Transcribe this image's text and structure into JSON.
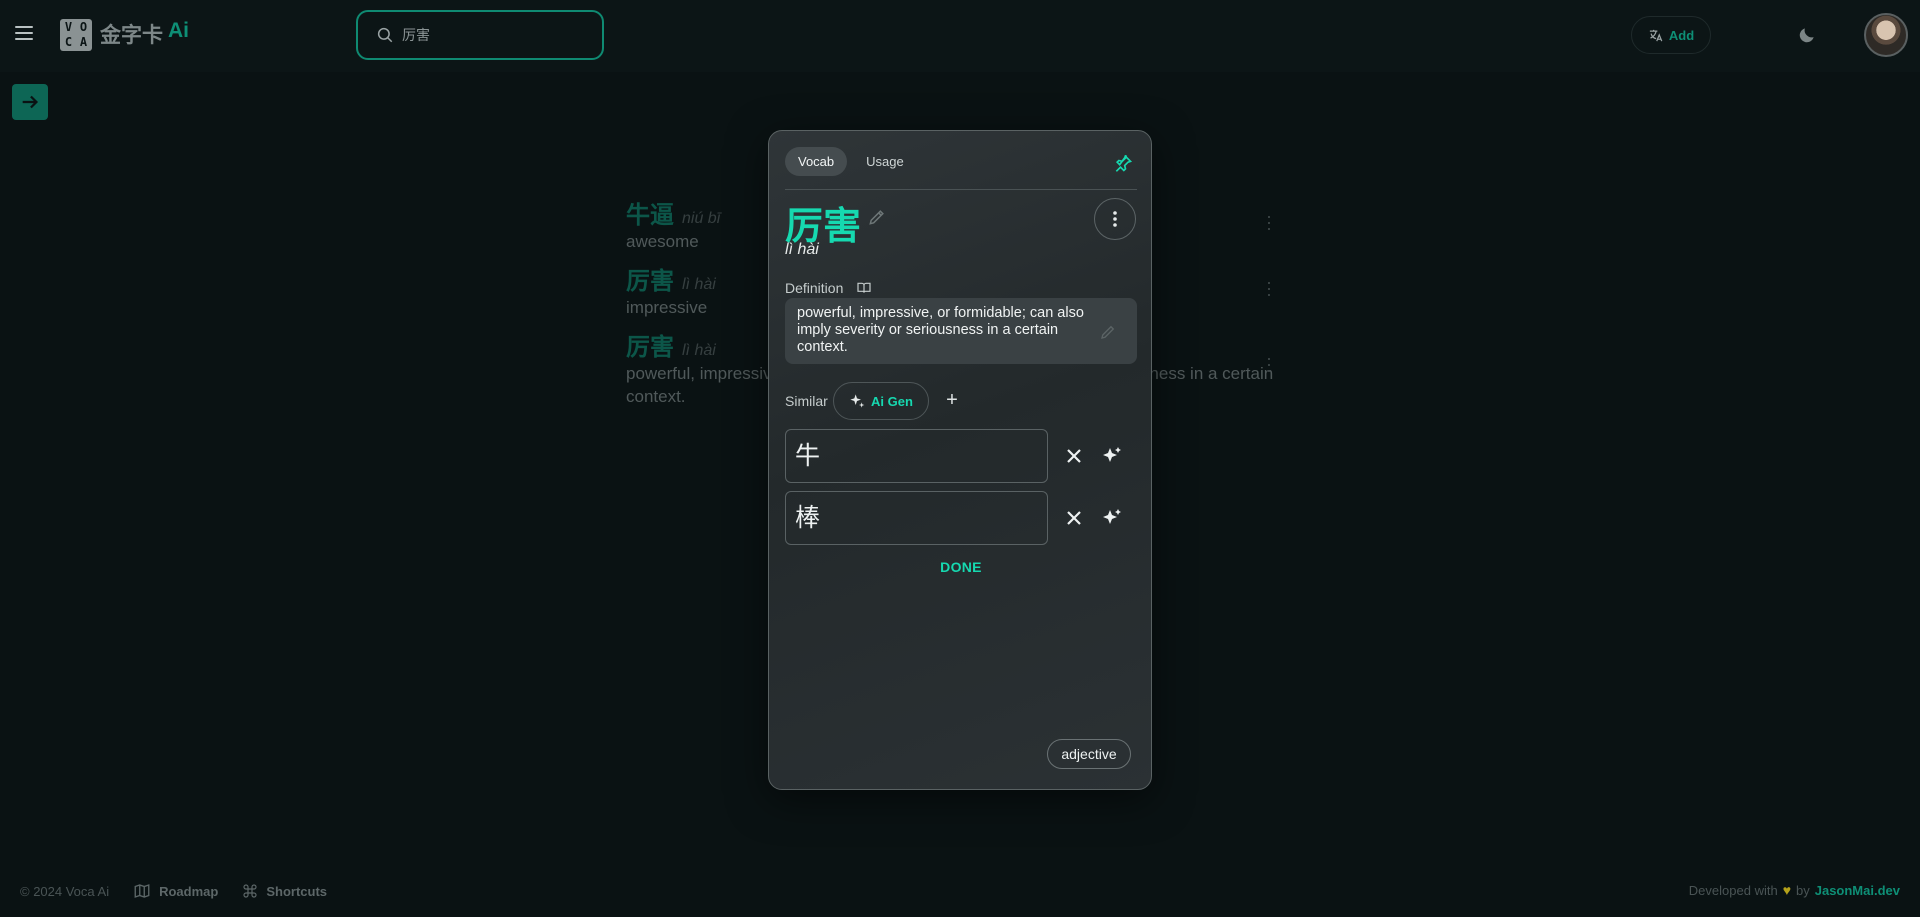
{
  "header": {
    "logo_letters": [
      "V",
      "O",
      "C",
      "A"
    ],
    "logo_text": "金字卡",
    "logo_ai": "Ai",
    "search": {
      "value": "厉害"
    },
    "add_label": "Add"
  },
  "vocab_list": [
    {
      "word": "牛逼",
      "pinyin": "niú bī",
      "definition": "awesome"
    },
    {
      "word": "厉害",
      "pinyin": "lì hài",
      "definition": "impressive"
    },
    {
      "word": "厉害",
      "pinyin": "lì hài",
      "definition": "powerful, impressive, or formidable; can also imply severity or seriousness in a certain context."
    }
  ],
  "card": {
    "tabs": [
      {
        "label": "Vocab",
        "active": true
      },
      {
        "label": "Usage",
        "active": false
      }
    ],
    "word": "厉害",
    "pinyin": "lì hài",
    "definition_label": "Definition",
    "definition": "powerful, impressive, or formidable; can also imply severity or seriousness in a certain context.",
    "similar_label": "Similar",
    "ai_gen_label": "Ai Gen",
    "similar_words": [
      "牛",
      "棒"
    ],
    "done_label": "DONE",
    "part_of_speech": "adjective"
  },
  "footer": {
    "copyright": "© 2024 Voca Ai",
    "roadmap": "Roadmap",
    "shortcuts": "Shortcuts",
    "developed_with": "Developed with",
    "by": "by",
    "developer": "JasonMai.dev"
  },
  "colors": {
    "accent": "#16d9b0",
    "accent_dark": "#0e8f76",
    "background": "#0a1213",
    "card": "#2a3033"
  }
}
